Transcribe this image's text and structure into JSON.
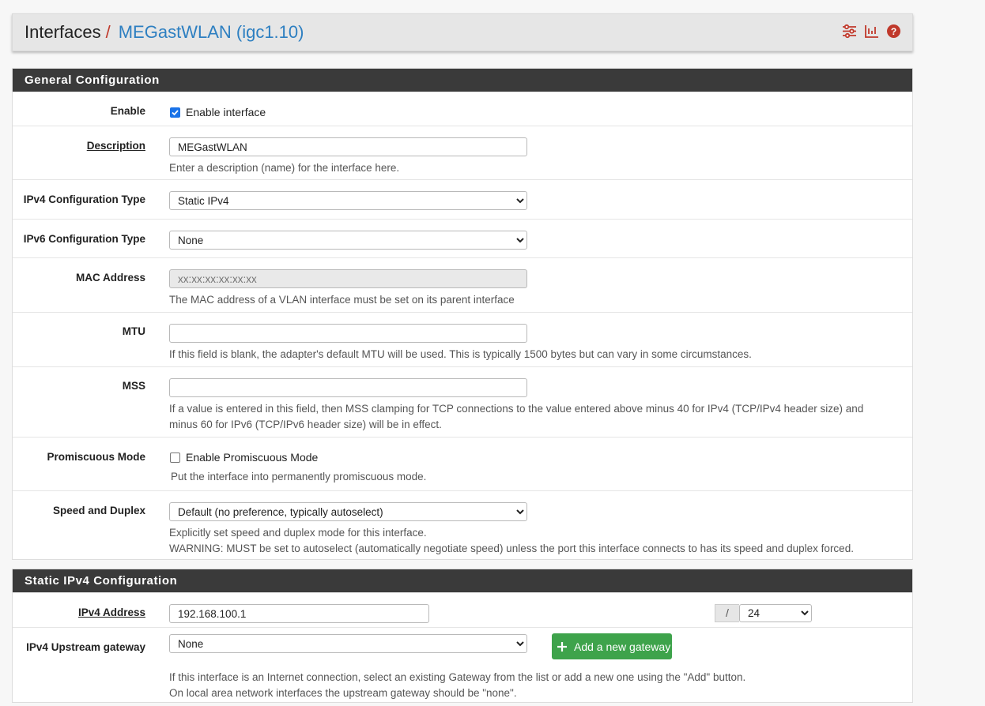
{
  "breadcrumb": {
    "root": "Interfaces",
    "separator": "/",
    "current": "MEGastWLAN (igc1.10)",
    "icons": [
      "sliders-icon",
      "bar-chart-icon",
      "help-icon"
    ]
  },
  "general": {
    "heading": "General Configuration",
    "enable": {
      "label": "Enable",
      "checkbox_label": "Enable interface",
      "checked": true
    },
    "description": {
      "label": "Description",
      "value": "MEGastWLAN",
      "help": "Enter a description (name) for the interface here."
    },
    "ipv4_type": {
      "label": "IPv4 Configuration Type",
      "selected": "Static IPv4"
    },
    "ipv6_type": {
      "label": "IPv6 Configuration Type",
      "selected": "None"
    },
    "mac": {
      "label": "MAC Address",
      "placeholder": "xx:xx:xx:xx:xx:xx",
      "help": "The MAC address of a VLAN interface must be set on its parent interface"
    },
    "mtu": {
      "label": "MTU",
      "value": "",
      "help": "If this field is blank, the adapter's default MTU will be used. This is typically 1500 bytes but can vary in some circumstances."
    },
    "mss": {
      "label": "MSS",
      "value": "",
      "help_line1": "If a value is entered in this field, then MSS clamping for TCP connections to the value entered above minus 40 for IPv4 (TCP/IPv4 header size) and",
      "help_line2": "minus 60 for IPv6 (TCP/IPv6 header size) will be in effect."
    },
    "promisc": {
      "label": "Promiscuous Mode",
      "checkbox_label": "Enable Promiscuous Mode",
      "checked": false,
      "help": "Put the interface into permanently promiscuous mode."
    },
    "speed": {
      "label": "Speed and Duplex",
      "selected": "Default (no preference, typically autoselect)",
      "help_line1": "Explicitly set speed and duplex mode for this interface.",
      "help_line2": "WARNING: MUST be set to autoselect (automatically negotiate speed) unless the port this interface connects to has its speed and duplex forced."
    }
  },
  "static_ipv4": {
    "heading": "Static IPv4 Configuration",
    "address": {
      "label": "IPv4 Address",
      "value": "192.168.100.1",
      "slash": "/",
      "cidr": "24"
    },
    "gateway": {
      "label": "IPv4 Upstream gateway",
      "selected": "None",
      "add_button": "Add a new gateway",
      "help_line1": "If this interface is an Internet connection, select an existing Gateway from the list or add a new one using the \"Add\" button.",
      "help_line2": "On local area network interfaces the upstream gateway should be \"none\"."
    }
  },
  "colors": {
    "heading_bg": "#3a3a3a",
    "link_blue": "#2d7fc1",
    "accent_red": "#c0392b",
    "success_green": "#3ea34b"
  }
}
